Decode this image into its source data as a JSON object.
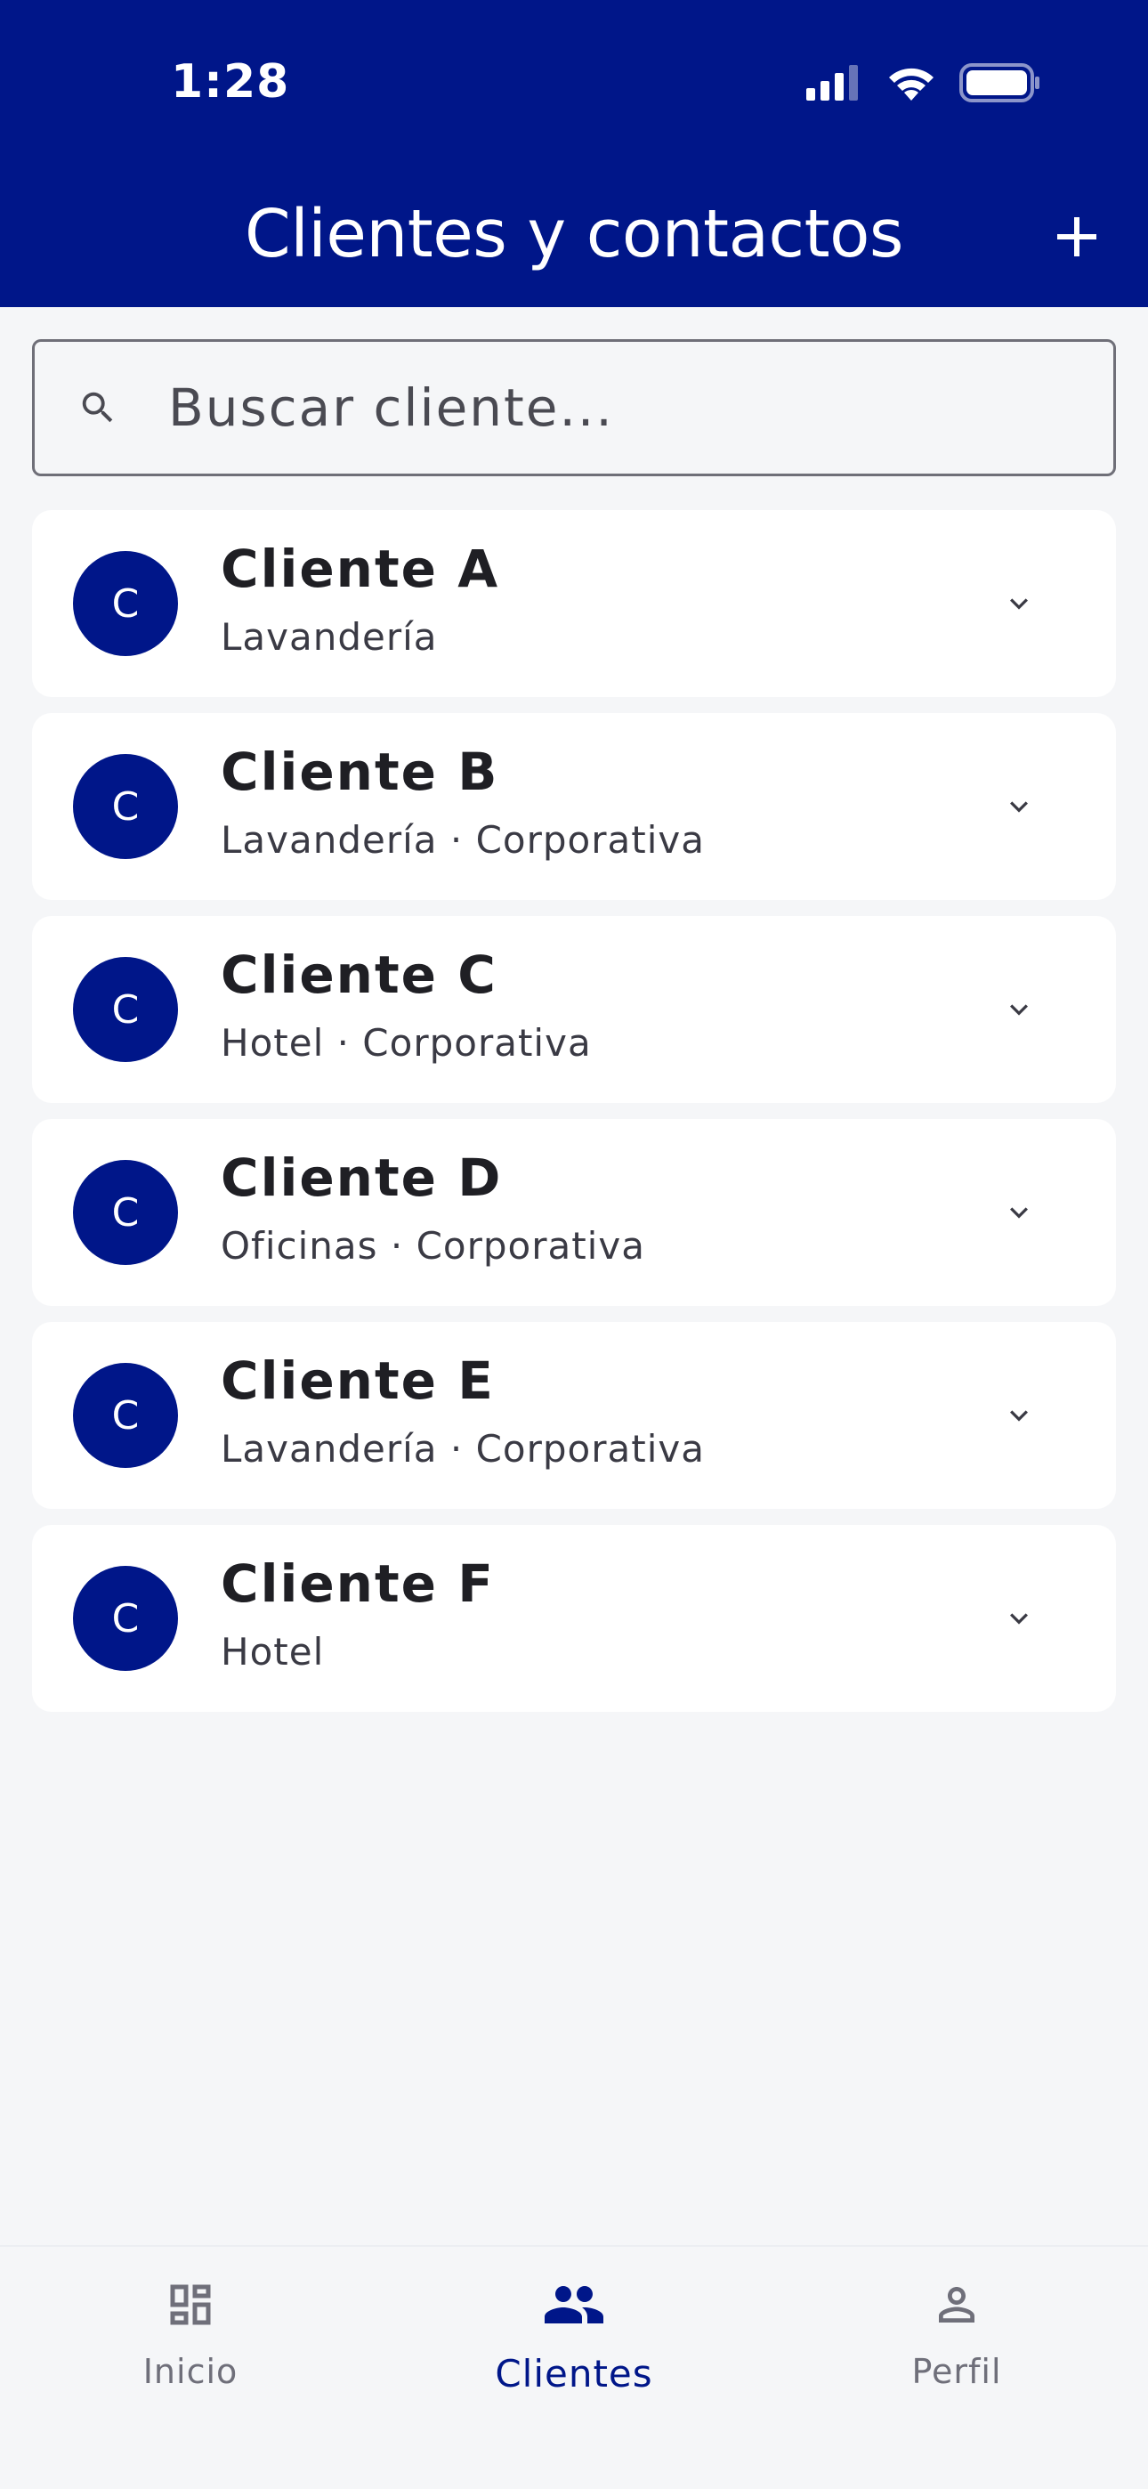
{
  "colors": {
    "primary": "#001689",
    "background": "#f5f6f8",
    "card": "#ffffff"
  },
  "status_bar": {
    "time": "1:28",
    "icons": [
      "cellular-signal-icon",
      "wifi-icon",
      "battery-icon"
    ]
  },
  "header": {
    "title": "Clientes y contactos",
    "add_icon": "plus-icon"
  },
  "search": {
    "placeholder": "Buscar cliente...",
    "value": "",
    "icon": "search-icon"
  },
  "clients": [
    {
      "initial": "C",
      "name": "Cliente A",
      "subtitle": "Lavandería"
    },
    {
      "initial": "C",
      "name": "Cliente B",
      "subtitle": "Lavandería · Corporativa"
    },
    {
      "initial": "C",
      "name": "Cliente C",
      "subtitle": "Hotel · Corporativa"
    },
    {
      "initial": "C",
      "name": "Cliente D",
      "subtitle": "Oficinas · Corporativa"
    },
    {
      "initial": "C",
      "name": "Cliente E",
      "subtitle": "Lavandería · Corporativa"
    },
    {
      "initial": "C",
      "name": "Cliente F",
      "subtitle": "Hotel"
    }
  ],
  "bottom_nav": {
    "items": [
      {
        "label": "Inicio",
        "icon": "dashboard-icon",
        "active": false
      },
      {
        "label": "Clientes",
        "icon": "people-icon",
        "active": true
      },
      {
        "label": "Perfil",
        "icon": "person-icon",
        "active": false
      }
    ]
  }
}
